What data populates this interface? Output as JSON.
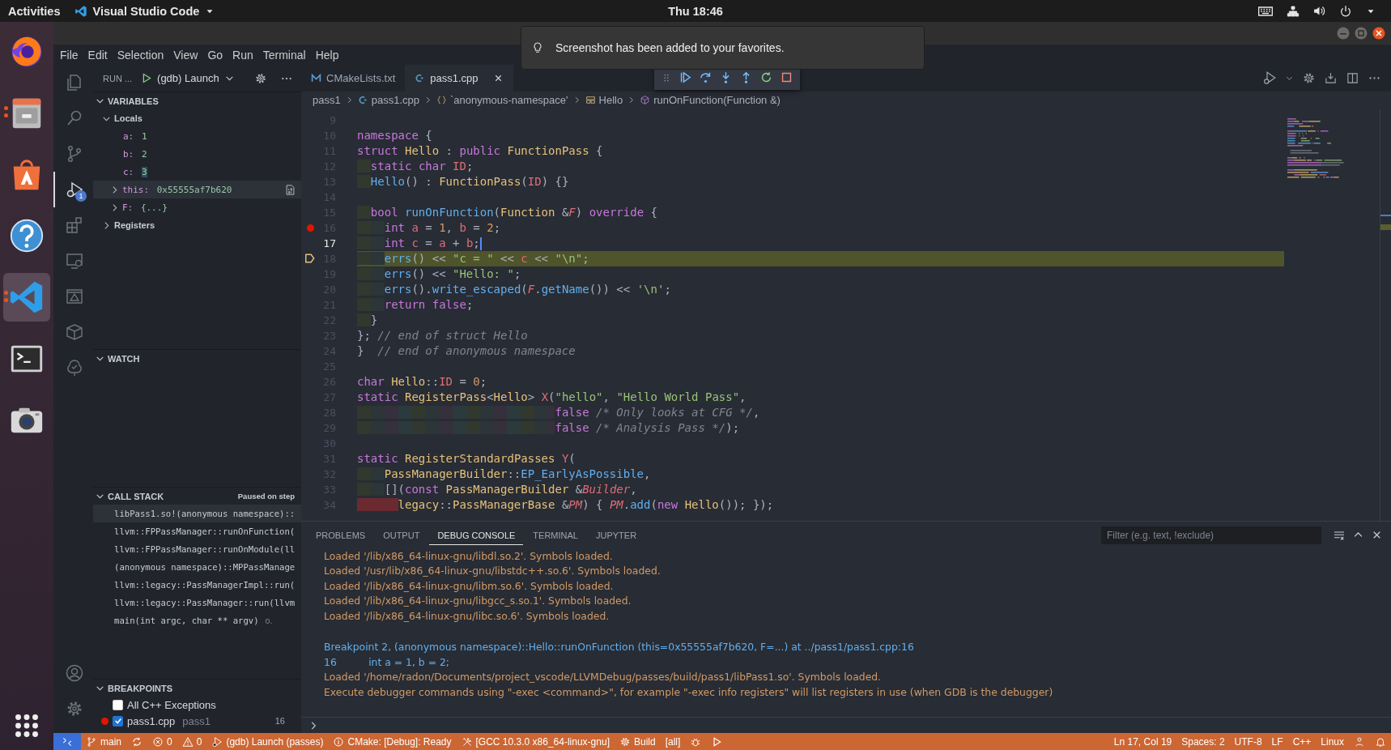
{
  "top_bar": {
    "activities": "Activities",
    "app_name": "Visual Studio Code",
    "clock": "Thu 18:46"
  },
  "dock": [
    {
      "kind": "browser",
      "running": false,
      "selected": false
    },
    {
      "kind": "files",
      "running": true,
      "selected": false
    },
    {
      "kind": "store",
      "running": false,
      "selected": false
    },
    {
      "kind": "help",
      "running": false,
      "selected": false
    },
    {
      "kind": "editor",
      "running": true,
      "selected": true
    },
    {
      "kind": "terminal",
      "running": false,
      "selected": false
    },
    {
      "kind": "camera",
      "running": false,
      "selected": false
    }
  ],
  "notification": {
    "text": "Screenshot has been added to your favorites."
  },
  "menu": [
    "File",
    "Edit",
    "Selection",
    "View",
    "Go",
    "Run",
    "Terminal",
    "Help"
  ],
  "activity_bar": [
    {
      "kind": "explorer",
      "selected": false
    },
    {
      "kind": "search",
      "selected": false
    },
    {
      "kind": "scm",
      "selected": false
    },
    {
      "kind": "debug",
      "selected": true,
      "badge": "1"
    },
    {
      "kind": "extensions",
      "selected": false
    },
    {
      "kind": "remote",
      "selected": false
    },
    {
      "kind": "cmake",
      "selected": false
    },
    {
      "kind": "package",
      "selected": false
    },
    {
      "kind": "test",
      "selected": false
    }
  ],
  "run_view": {
    "title": "RUN ...",
    "config": "(gdb) Launch"
  },
  "variables": {
    "title": "VARIABLES",
    "expanded": true,
    "scopes": [
      {
        "label": "Locals",
        "expanded": true,
        "children": [
          {
            "name": "a:",
            "value": "1",
            "kind": "value",
            "changed": false,
            "selected": false
          },
          {
            "name": "b:",
            "value": "2",
            "kind": "value",
            "changed": false,
            "selected": false
          },
          {
            "name": "c:",
            "value": "3",
            "kind": "value",
            "changed": true,
            "selected": false
          },
          {
            "name": "this:",
            "value": "0x55555af7b620",
            "kind": "object",
            "changed": false,
            "selected": true
          },
          {
            "name": "F:",
            "value": "{...}",
            "kind": "object",
            "changed": false,
            "selected": false
          }
        ]
      },
      {
        "label": "Registers",
        "expanded": false
      }
    ]
  },
  "watch": {
    "title": "WATCH",
    "expanded": true
  },
  "call_stack": {
    "title": "CALL STACK",
    "expanded": true,
    "status": "Paused on step",
    "frames": [
      {
        "label": "libPass1.so!(anonymous namespace)::",
        "selected": true
      },
      {
        "label": "llvm::FPPassManager::runOnFunction(",
        "selected": false
      },
      {
        "label": "llvm::FPPassManager::runOnModule(ll",
        "selected": false
      },
      {
        "label": "(anonymous namespace)::MPPassManage",
        "selected": false
      },
      {
        "label": "llvm::legacy::PassManagerImpl::run(",
        "selected": false
      },
      {
        "label": "llvm::legacy::PassManager::run(llvm",
        "selected": false
      },
      {
        "label": "main(int argc, char ** argv)",
        "selected": false,
        "source": "o."
      }
    ]
  },
  "breakpoints": {
    "title": "BREAKPOINTS",
    "expanded": true,
    "items": [
      {
        "kind": "exception",
        "label": "All C++ Exceptions",
        "checked": false
      },
      {
        "kind": "file",
        "label": "pass1.cpp",
        "folder": "pass1",
        "line": "16",
        "checked": true
      }
    ]
  },
  "editor_tabs": [
    {
      "label": "CMakeLists.txt",
      "kind": "cmake",
      "selected": false
    },
    {
      "label": "pass1.cpp",
      "kind": "cpp",
      "selected": true
    }
  ],
  "breadcrumbs": [
    {
      "label": "pass1",
      "kind": "folder"
    },
    {
      "label": "pass1.cpp",
      "kind": "cpp"
    },
    {
      "label": "`anonymous-namespace'",
      "kind": "namespace"
    },
    {
      "label": "Hello",
      "kind": "struct"
    },
    {
      "label": "runOnFunction(Function &)",
      "kind": "method"
    }
  ],
  "code": [
    {
      "number": "9",
      "breakpoint": false,
      "paused": false,
      "cursor": false
    },
    {
      "number": "10",
      "breakpoint": false,
      "paused": false,
      "cursor": false,
      "tokens": [
        {
          "kind": "kw",
          "text": "namespace"
        },
        {
          "kind": "p",
          "text": " {"
        }
      ]
    },
    {
      "number": "11",
      "breakpoint": false,
      "paused": false,
      "cursor": false,
      "tokens": [
        {
          "kind": "kw",
          "text": "struct "
        },
        {
          "kind": "type",
          "text": "Hello"
        },
        {
          "kind": "p",
          "text": " : "
        },
        {
          "kind": "kw",
          "text": "public "
        },
        {
          "kind": "type",
          "text": "FunctionPass"
        },
        {
          "kind": "p",
          "text": " {"
        }
      ]
    },
    {
      "number": "12",
      "breakpoint": false,
      "paused": false,
      "cursor": false,
      "tokens": [
        {
          "kind": "kw",
          "text": "  static "
        },
        {
          "kind": "kw",
          "text": "char "
        },
        {
          "kind": "var",
          "text": "ID"
        },
        {
          "kind": "p",
          "text": ";"
        }
      ]
    },
    {
      "number": "13",
      "breakpoint": false,
      "paused": false,
      "cursor": false,
      "tokens": [
        {
          "kind": "fn",
          "text": "  Hello"
        },
        {
          "kind": "p",
          "text": "() : "
        },
        {
          "kind": "type",
          "text": "FunctionPass"
        },
        {
          "kind": "p",
          "text": "("
        },
        {
          "kind": "var",
          "text": "ID"
        },
        {
          "kind": "p",
          "text": ") {}"
        }
      ]
    },
    {
      "number": "14",
      "breakpoint": false,
      "paused": false,
      "cursor": false
    },
    {
      "number": "15",
      "breakpoint": false,
      "paused": false,
      "cursor": false,
      "tokens": [
        {
          "kind": "kw",
          "text": "  bool "
        },
        {
          "kind": "fn",
          "text": "runOnFunction"
        },
        {
          "kind": "p",
          "text": "("
        },
        {
          "kind": "type",
          "text": "Function"
        },
        {
          "kind": "p",
          "text": " &"
        },
        {
          "kind": "param",
          "text": "F"
        },
        {
          "kind": "p",
          "text": ") "
        },
        {
          "kind": "kw",
          "text": "override"
        },
        {
          "kind": "p",
          "text": " {"
        }
      ]
    },
    {
      "number": "16",
      "breakpoint": true,
      "paused": false,
      "cursor": false,
      "tokens": [
        {
          "kind": "kw",
          "text": "    int "
        },
        {
          "kind": "var",
          "text": "a"
        },
        {
          "kind": "p",
          "text": " = "
        },
        {
          "kind": "num",
          "text": "1"
        },
        {
          "kind": "p",
          "text": ", "
        },
        {
          "kind": "var",
          "text": "b"
        },
        {
          "kind": "p",
          "text": " = "
        },
        {
          "kind": "num",
          "text": "2"
        },
        {
          "kind": "p",
          "text": ";"
        }
      ]
    },
    {
      "number": "17",
      "breakpoint": false,
      "paused": false,
      "cursor": true,
      "tokens": [
        {
          "kind": "kw",
          "text": "    int "
        },
        {
          "kind": "var",
          "text": "c"
        },
        {
          "kind": "p",
          "text": " = "
        },
        {
          "kind": "var",
          "text": "a"
        },
        {
          "kind": "p",
          "text": " + "
        },
        {
          "kind": "var",
          "text": "b"
        },
        {
          "kind": "p",
          "text": ";"
        }
      ]
    },
    {
      "number": "18",
      "breakpoint": false,
      "paused": true,
      "cursor": false,
      "tokens": [
        {
          "kind": "fn",
          "text": "    errs"
        },
        {
          "kind": "p",
          "text": "() << "
        },
        {
          "kind": "str",
          "text": "\"c = \""
        },
        {
          "kind": "p",
          "text": " << "
        },
        {
          "kind": "var",
          "text": "c"
        },
        {
          "kind": "p",
          "text": " << "
        },
        {
          "kind": "str",
          "text": "\"\\n\""
        },
        {
          "kind": "p",
          "text": ";"
        }
      ]
    },
    {
      "number": "19",
      "breakpoint": false,
      "paused": false,
      "cursor": false,
      "tokens": [
        {
          "kind": "fn",
          "text": "    errs"
        },
        {
          "kind": "p",
          "text": "() << "
        },
        {
          "kind": "str",
          "text": "\"Hello: \""
        },
        {
          "kind": "p",
          "text": ";"
        }
      ]
    },
    {
      "number": "20",
      "breakpoint": false,
      "paused": false,
      "cursor": false,
      "tokens": [
        {
          "kind": "fn",
          "text": "    errs"
        },
        {
          "kind": "p",
          "text": "()."
        },
        {
          "kind": "fn",
          "text": "write_escaped"
        },
        {
          "kind": "p",
          "text": "("
        },
        {
          "kind": "param",
          "text": "F"
        },
        {
          "kind": "p",
          "text": "."
        },
        {
          "kind": "fn",
          "text": "getName"
        },
        {
          "kind": "p",
          "text": "()) << "
        },
        {
          "kind": "str",
          "text": "'\\n'"
        },
        {
          "kind": "p",
          "text": ";"
        }
      ]
    },
    {
      "number": "21",
      "breakpoint": false,
      "paused": false,
      "cursor": false,
      "tokens": [
        {
          "kind": "kw",
          "text": "    return "
        },
        {
          "kind": "kw",
          "text": "false"
        },
        {
          "kind": "p",
          "text": ";"
        }
      ]
    },
    {
      "number": "22",
      "breakpoint": false,
      "paused": false,
      "cursor": false,
      "tokens": [
        {
          "kind": "p",
          "text": "  }"
        }
      ]
    },
    {
      "number": "23",
      "breakpoint": false,
      "paused": false,
      "cursor": false,
      "tokens": [
        {
          "kind": "p",
          "text": "}; "
        },
        {
          "kind": "cm",
          "text": "// end of struct Hello"
        }
      ]
    },
    {
      "number": "24",
      "breakpoint": false,
      "paused": false,
      "cursor": false,
      "tokens": [
        {
          "kind": "p",
          "text": "}  "
        },
        {
          "kind": "cm",
          "text": "// end of anonymous namespace"
        }
      ]
    },
    {
      "number": "25",
      "breakpoint": false,
      "paused": false,
      "cursor": false
    },
    {
      "number": "26",
      "breakpoint": false,
      "paused": false,
      "cursor": false,
      "tokens": [
        {
          "kind": "kw",
          "text": "char "
        },
        {
          "kind": "type",
          "text": "Hello"
        },
        {
          "kind": "p",
          "text": "::"
        },
        {
          "kind": "var",
          "text": "ID"
        },
        {
          "kind": "p",
          "text": " = "
        },
        {
          "kind": "num",
          "text": "0"
        },
        {
          "kind": "p",
          "text": ";"
        }
      ]
    },
    {
      "number": "27",
      "breakpoint": false,
      "paused": false,
      "cursor": false,
      "tokens": [
        {
          "kind": "kw",
          "text": "static "
        },
        {
          "kind": "type",
          "text": "RegisterPass"
        },
        {
          "kind": "p",
          "text": "<"
        },
        {
          "kind": "type",
          "text": "Hello"
        },
        {
          "kind": "p",
          "text": "> "
        },
        {
          "kind": "var",
          "text": "X"
        },
        {
          "kind": "p",
          "text": "("
        },
        {
          "kind": "str",
          "text": "\"hello\""
        },
        {
          "kind": "p",
          "text": ", "
        },
        {
          "kind": "str",
          "text": "\"Hello World Pass\""
        },
        {
          "kind": "p",
          "text": ","
        }
      ]
    },
    {
      "number": "28",
      "breakpoint": false,
      "paused": false,
      "cursor": false,
      "tokens": [
        {
          "kind": "kw",
          "text": "                             false "
        },
        {
          "kind": "cm",
          "text": "/* Only looks at CFG */"
        },
        {
          "kind": "p",
          "text": ","
        }
      ]
    },
    {
      "number": "29",
      "breakpoint": false,
      "paused": false,
      "cursor": false,
      "tokens": [
        {
          "kind": "kw",
          "text": "                             false "
        },
        {
          "kind": "cm",
          "text": "/* Analysis Pass */"
        },
        {
          "kind": "p",
          "text": ");"
        }
      ]
    },
    {
      "number": "30",
      "breakpoint": false,
      "paused": false,
      "cursor": false
    },
    {
      "number": "31",
      "breakpoint": false,
      "paused": false,
      "cursor": false,
      "tokens": [
        {
          "kind": "kw",
          "text": "static "
        },
        {
          "kind": "type",
          "text": "RegisterStandardPasses "
        },
        {
          "kind": "var",
          "text": "Y"
        },
        {
          "kind": "p",
          "text": "("
        }
      ]
    },
    {
      "number": "32",
      "breakpoint": false,
      "paused": false,
      "cursor": false,
      "tokens": [
        {
          "kind": "type",
          "text": "    PassManagerBuilder"
        },
        {
          "kind": "p",
          "text": "::"
        },
        {
          "kind": "fn",
          "text": "EP_EarlyAsPossible"
        },
        {
          "kind": "p",
          "text": ","
        }
      ]
    },
    {
      "number": "33",
      "breakpoint": false,
      "paused": false,
      "cursor": false,
      "tokens": [
        {
          "kind": "p",
          "text": "    []("
        },
        {
          "kind": "kw",
          "text": "const "
        },
        {
          "kind": "type",
          "text": "PassManagerBuilder"
        },
        {
          "kind": "p",
          "text": " &"
        },
        {
          "kind": "param",
          "text": "Builder"
        },
        {
          "kind": "p",
          "text": ","
        }
      ]
    },
    {
      "number": "34",
      "breakpoint": false,
      "paused": false,
      "cursor": false,
      "indent_error": true,
      "tokens": [
        {
          "kind": "type",
          "text": "      legacy"
        },
        {
          "kind": "p",
          "text": "::"
        },
        {
          "kind": "type",
          "text": "PassManagerBase"
        },
        {
          "kind": "p",
          "text": " &"
        },
        {
          "kind": "param",
          "text": "PM"
        },
        {
          "kind": "p",
          "text": ") { "
        },
        {
          "kind": "param",
          "text": "PM"
        },
        {
          "kind": "p",
          "text": "."
        },
        {
          "kind": "fn",
          "text": "add"
        },
        {
          "kind": "p",
          "text": "("
        },
        {
          "kind": "kw",
          "text": "new "
        },
        {
          "kind": "type",
          "text": "Hello"
        },
        {
          "kind": "p",
          "text": "()); });"
        }
      ]
    }
  ],
  "panel": {
    "tabs": [
      {
        "label": "PROBLEMS",
        "selected": false
      },
      {
        "label": "OUTPUT",
        "selected": false
      },
      {
        "label": "DEBUG CONSOLE",
        "selected": true
      },
      {
        "label": "TERMINAL",
        "selected": false
      },
      {
        "label": "JUPYTER",
        "selected": false
      }
    ],
    "filter": {
      "placeholder": "Filter (e.g. text, !exclude)"
    },
    "console": [
      {
        "lines": [
          {
            "kind": "info",
            "text": "Loaded '/lib/x86_64-linux-gnu/libdl.so.2'. Symbols loaded."
          },
          {
            "kind": "info",
            "text": "Loaded '/usr/lib/x86_64-linux-gnu/libstdc++.so.6'. Symbols loaded."
          },
          {
            "kind": "info",
            "text": "Loaded '/lib/x86_64-linux-gnu/libm.so.6'. Symbols loaded."
          },
          {
            "kind": "info",
            "text": "Loaded '/lib/x86_64-linux-gnu/libgcc_s.so.1'. Symbols loaded."
          },
          {
            "kind": "info",
            "text": "Loaded '/lib/x86_64-linux-gnu/libc.so.6'. Symbols loaded."
          }
        ]
      },
      {
        "lines": [
          {
            "kind": "debug",
            "text": "Breakpoint 2, (anonymous namespace)::Hello::runOnFunction (this=0x55555af7b620, F=...) at ../pass1/pass1.cpp:16"
          },
          {
            "kind": "debug",
            "text": "16          int a = 1, b = 2;"
          },
          {
            "kind": "info",
            "text": "Loaded '/home/radon/Documents/project_vscode/LLVMDebug/passes/build/pass1/libPass1.so'. Symbols loaded."
          },
          {
            "kind": "info",
            "text": "Execute debugger commands using \"-exec <command>\", for example \"-exec info registers\" will list registers in use (when GDB is the debugger)"
          }
        ]
      }
    ]
  },
  "status_bar": {
    "left": [
      {
        "kind": "remote"
      },
      {
        "kind": "branch",
        "text": "main"
      },
      {
        "kind": "sync"
      },
      {
        "kind": "errors",
        "text": "0"
      },
      {
        "kind": "warnings",
        "text": "0"
      },
      {
        "kind": "launch",
        "text": "(gdb) Launch (passes)"
      },
      {
        "kind": "cmake",
        "text": "CMake: [Debug]: Ready"
      },
      {
        "kind": "kit",
        "text": "[GCC 10.3.0 x86_64-linux-gnu]"
      },
      {
        "kind": "build",
        "text": "Build"
      },
      {
        "kind": "plain",
        "text": "[all]"
      },
      {
        "kind": "bug"
      },
      {
        "kind": "run"
      }
    ],
    "right": [
      {
        "kind": "plain",
        "text": "Ln 17, Col 19"
      },
      {
        "kind": "plain",
        "text": "Spaces: 2"
      },
      {
        "kind": "plain",
        "text": "UTF-8"
      },
      {
        "kind": "plain",
        "text": "LF"
      },
      {
        "kind": "plain",
        "text": "C++"
      },
      {
        "kind": "plain",
        "text": "Linux"
      },
      {
        "kind": "account"
      },
      {
        "kind": "bell"
      }
    ]
  }
}
